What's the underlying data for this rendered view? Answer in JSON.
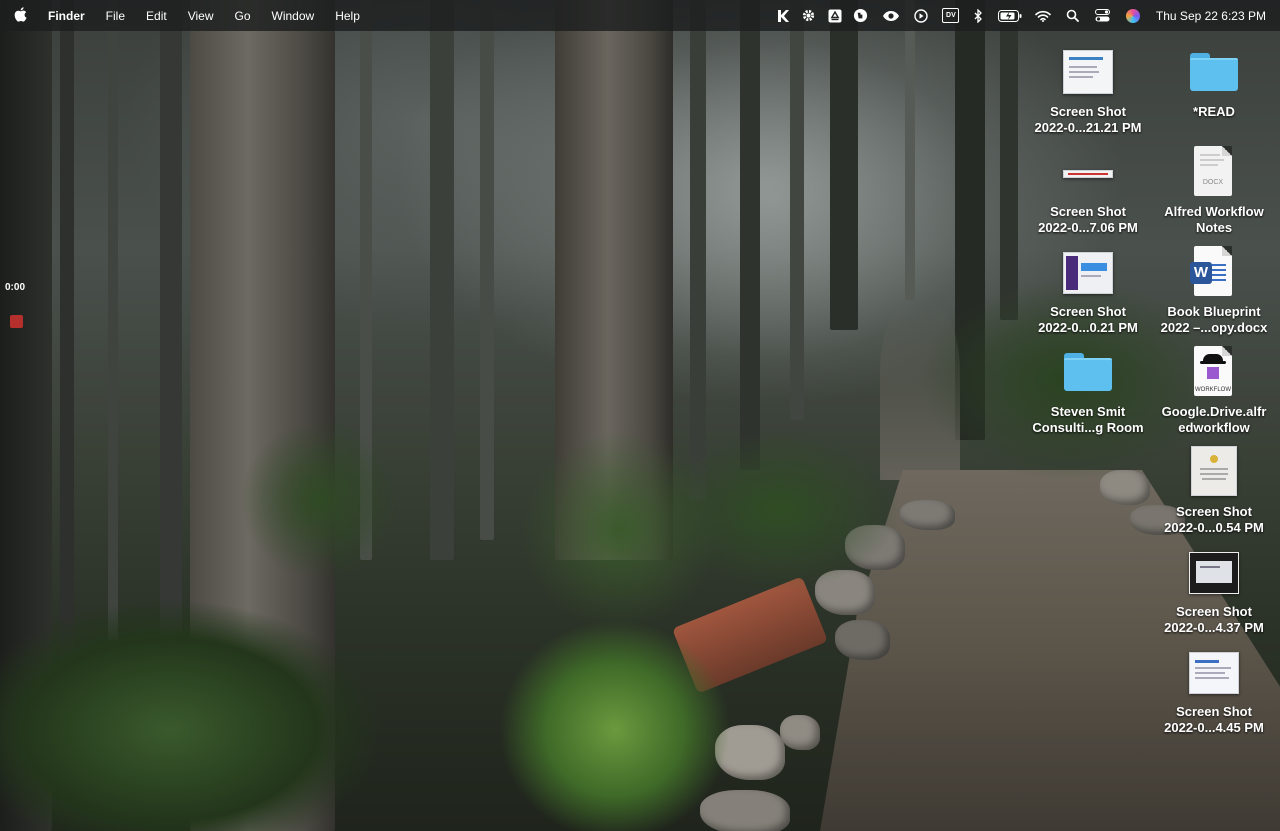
{
  "menubar": {
    "app_name": "Finder",
    "menus": [
      "File",
      "Edit",
      "View",
      "Go",
      "Window",
      "Help"
    ],
    "status_icons": [
      "keyboard-maestro-icon",
      "gear-icon",
      "google-drive-icon",
      "evernote-icon",
      "eye-icon",
      "play-icon",
      "dv-icon",
      "bluetooth-icon",
      "battery-icon",
      "wifi-icon",
      "search-icon",
      "control-center-icon",
      "siri-icon"
    ],
    "dv_label": "DV",
    "clock": "Thu Sep 22  6:23 PM"
  },
  "recorder": {
    "time": "0:00"
  },
  "desktop": {
    "icons": [
      {
        "name": "screenshot-1",
        "kind": "screenshot",
        "label_line1": "Screen Shot",
        "label_line2": "2022-0...21.21 PM"
      },
      {
        "name": "read-folder",
        "kind": "folder",
        "label_line1": "*READ",
        "label_line2": ""
      },
      {
        "name": "screenshot-2",
        "kind": "screenshot",
        "label_line1": "Screen Shot",
        "label_line2": "2022-0...7.06 PM"
      },
      {
        "name": "alfred-workflow-notes",
        "kind": "docx",
        "label_line1": "Alfred Workflow",
        "label_line2": "Notes",
        "tag": "DOCX"
      },
      {
        "name": "screenshot-3",
        "kind": "screenshot",
        "label_line1": "Screen Shot",
        "label_line2": "2022-0...0.21 PM"
      },
      {
        "name": "book-blueprint",
        "kind": "word",
        "label_line1": "Book Blueprint",
        "label_line2": "2022 –...opy.docx",
        "tag": "W"
      },
      {
        "name": "steven-smit-folder",
        "kind": "folder",
        "label_line1": "Steven Smit",
        "label_line2": "Consulti...g Room"
      },
      {
        "name": "google-drive-workflow",
        "kind": "workflow",
        "label_line1": "Google.Drive.alfr",
        "label_line2": "edworkflow",
        "tag": "WORKFLOW"
      },
      {
        "name": "screenshot-4",
        "kind": "screenshot",
        "label_line1": "Screen Shot",
        "label_line2": "2022-0...0.54 PM"
      },
      {
        "name": "screenshot-5",
        "kind": "screenshot",
        "label_line1": "Screen Shot",
        "label_line2": "2022-0...4.37 PM"
      },
      {
        "name": "screenshot-6",
        "kind": "screenshot",
        "label_line1": "Screen Shot",
        "label_line2": "2022-0...4.45 PM"
      }
    ]
  }
}
